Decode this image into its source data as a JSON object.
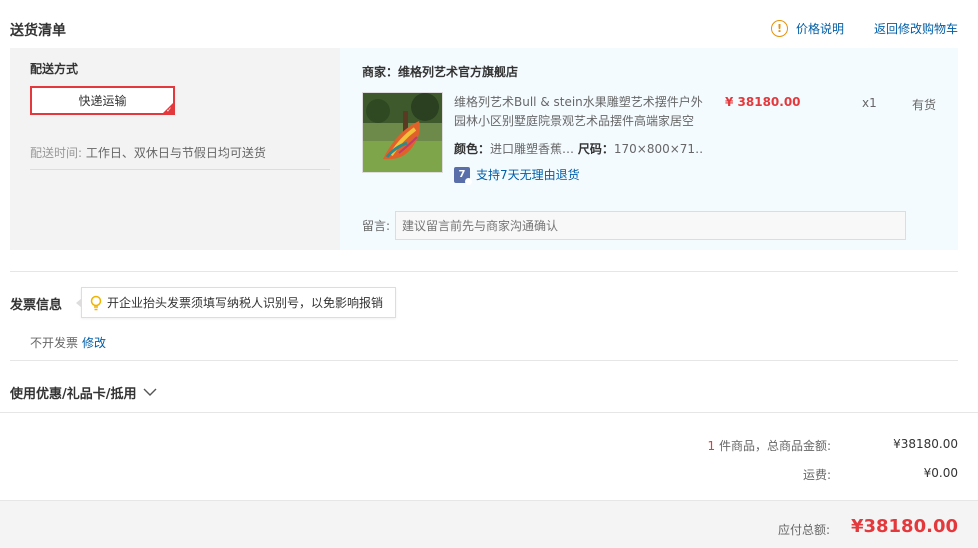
{
  "section_title": "送货清单",
  "top_links": {
    "price_info": "价格说明",
    "back_to_cart": "返回修改购物车"
  },
  "shipping": {
    "label": "配送方式",
    "option": "快递运输",
    "time_label": "配送时间:",
    "time_value": "工作日、双休日与节假日均可送货"
  },
  "shop": {
    "name": "商家：维格列艺术官方旗舰店",
    "product": {
      "title": "维格列艺术Bull & stein水果雕塑艺术摆件户外园林小区别墅庭院景观艺术品摆件高端家居空",
      "color_label": "颜色：",
      "color_value": "进口雕塑香蕉…",
      "size_label": "尺码：",
      "size_value": "170×800×71…",
      "return_icon_text": "7",
      "return_policy": "支持7天无理由退货",
      "price": "¥ 38180.00",
      "qty": "x1",
      "stock": "有货"
    },
    "message_label": "留言:",
    "message_placeholder": "建议留言前先与商家沟通确认"
  },
  "invoice": {
    "title": "发票信息",
    "tip": "开企业抬头发票须填写纳税人识别号，以免影响报销",
    "value": "不开发票",
    "edit": "修改"
  },
  "coupon": {
    "title": "使用优惠/礼品卡/抵用"
  },
  "summary": {
    "count": "1",
    "items_label": "件商品，总商品金额:",
    "items_total": "¥38180.00",
    "shipping_label": "运费:",
    "shipping_fee": "¥0.00",
    "payable_label": "应付总额:",
    "payable": "¥38180.00"
  },
  "colors": {
    "accent_red": "#e4393c",
    "link_blue": "#005ea7",
    "warn_orange": "#e4930f"
  }
}
